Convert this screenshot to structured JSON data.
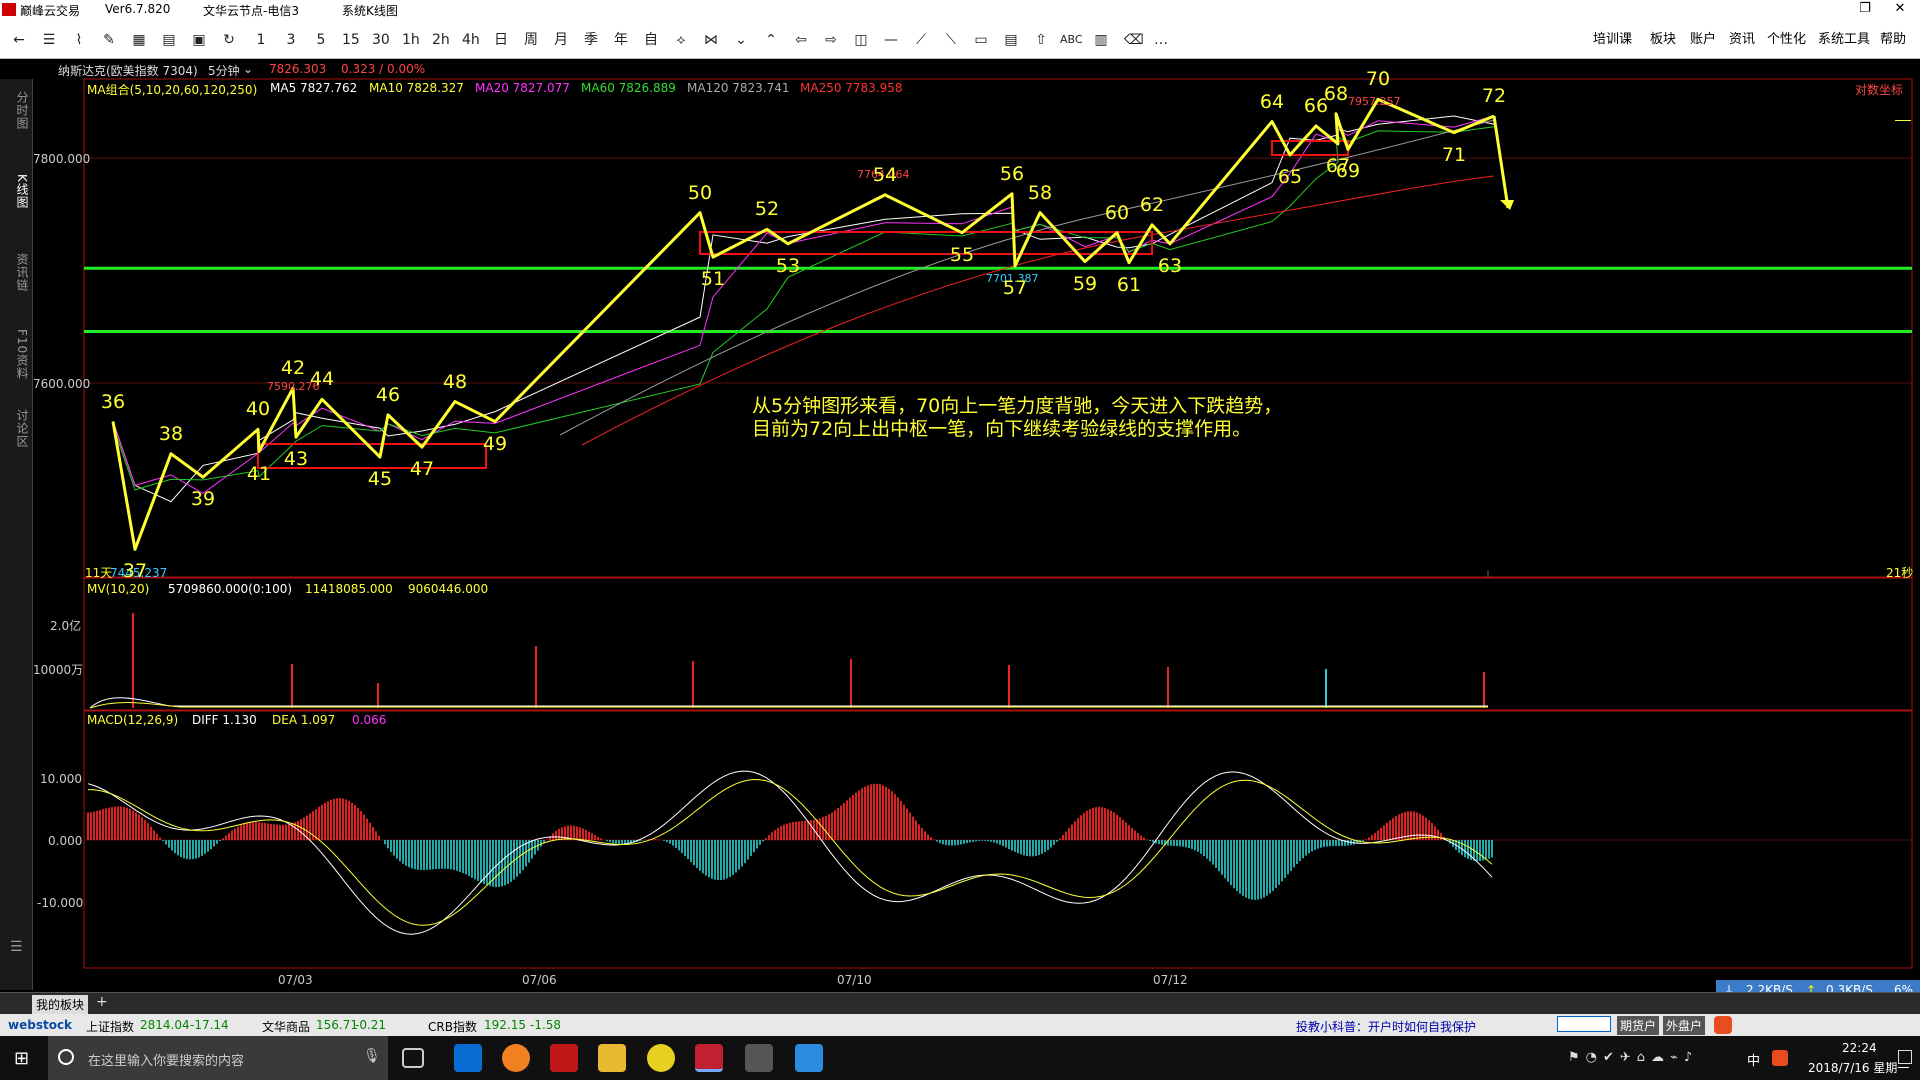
{
  "window": {
    "app_name": "巅峰云交易",
    "version": "Ver6.7.820",
    "server": "文华云节点-电信3",
    "menu_chart": "系统K线图",
    "close_icon": "close-icon",
    "maximize_icon": "maximize-icon"
  },
  "toolbar": {
    "periods": [
      "1",
      "3",
      "5",
      "15",
      "30",
      "1h",
      "2h",
      "4h",
      "日",
      "周",
      "月",
      "季",
      "年",
      "自"
    ],
    "abc_label": "ABC",
    "more_label": "…",
    "right_menu": [
      "培训课",
      "板块",
      "账户",
      "资讯",
      "个性化",
      "系统工具",
      "帮助"
    ]
  },
  "sidebar": {
    "tabs": [
      "分时图",
      "K线图",
      "资讯链",
      "F10资料",
      "讨论区"
    ]
  },
  "infobar": {
    "symbol": "纳斯达克(欧美指数 7304)",
    "period_label": "5分钟",
    "price": "7826.303",
    "change": "0.323 / 0.00%"
  },
  "ma_legend": {
    "name": "MA组合(5,10,20,60,120,250)",
    "items": [
      {
        "label": "MA5 7827.762",
        "color": "#ffffff"
      },
      {
        "label": "MA10 7828.327",
        "color": "#ffff33"
      },
      {
        "label": "MA20 7827.077",
        "color": "#ff33ff"
      },
      {
        "label": "MA60 7826.889",
        "color": "#33dd33"
      },
      {
        "label": "MA120 7823.741",
        "color": "#aaaaaa"
      },
      {
        "label": "MA250 7783.958",
        "color": "#ff3333"
      }
    ]
  },
  "labels": {
    "log_coord": "对数坐标",
    "days_label": "11天",
    "secs_label": "21秒",
    "min_price": "7445.237",
    "mark_7590": "7590.276",
    "mark_7764": "7764.064",
    "mark_7701": "7701.387",
    "mark_7957": "7957.257"
  },
  "annotation": {
    "line1": "从5分钟图形来看，70向上一笔力度背驰，今天进入下跌趋势，",
    "line2": "目前为72向上出中枢一笔，向下继续考验绿线的支撑作用。"
  },
  "volume_legend": {
    "name": "MV(10,20)",
    "v1": "5709860.000(0:100)",
    "v2": "11418085.000",
    "v3": "9060446.000"
  },
  "macd_legend": {
    "name": "MACD(12,26,9)",
    "diff": "DIFF 1.130",
    "dea": "DEA 1.097",
    "macd": "0.066"
  },
  "axes": {
    "price_ticks": [
      "7800.000",
      "7600.000"
    ],
    "volume_ticks": [
      "2.0亿",
      "10000万"
    ],
    "macd_ticks": [
      "10.000",
      "0.000",
      "-10.000"
    ],
    "date_ticks": [
      "07/03",
      "07/06",
      "07/10",
      "07/12"
    ]
  },
  "chart_data": {
    "type": "line",
    "waves": [
      {
        "label": "36",
        "price": 7560
      },
      {
        "label": "37",
        "price": 7445
      },
      {
        "label": "38",
        "price": 7531
      },
      {
        "label": "39",
        "price": 7510
      },
      {
        "label": "40",
        "price": 7553
      },
      {
        "label": "41",
        "price": 7533
      },
      {
        "label": "42",
        "price": 7590
      },
      {
        "label": "43",
        "price": 7546
      },
      {
        "label": "44",
        "price": 7580
      },
      {
        "label": "45",
        "price": 7528
      },
      {
        "label": "46",
        "price": 7566
      },
      {
        "label": "47",
        "price": 7537
      },
      {
        "label": "48",
        "price": 7578
      },
      {
        "label": "49",
        "price": 7560
      },
      {
        "label": "50",
        "price": 7748
      },
      {
        "label": "51",
        "price": 7708
      },
      {
        "label": "52",
        "price": 7733
      },
      {
        "label": "53",
        "price": 7720
      },
      {
        "label": "54",
        "price": 7764
      },
      {
        "label": "55",
        "price": 7730
      },
      {
        "label": "56",
        "price": 7765
      },
      {
        "label": "57",
        "price": 7700
      },
      {
        "label": "58",
        "price": 7748
      },
      {
        "label": "59",
        "price": 7704
      },
      {
        "label": "60",
        "price": 7730
      },
      {
        "label": "61",
        "price": 7703
      },
      {
        "label": "62",
        "price": 7737
      },
      {
        "label": "63",
        "price": 7720
      },
      {
        "label": "64",
        "price": 7830
      },
      {
        "label": "65",
        "price": 7800
      },
      {
        "label": "66",
        "price": 7826
      },
      {
        "label": "67",
        "price": 7810
      },
      {
        "label": "68",
        "price": 7837
      },
      {
        "label": "69",
        "price": 7805
      },
      {
        "label": "70",
        "price": 7850
      },
      {
        "label": "71",
        "price": 7820
      },
      {
        "label": "72",
        "price": 7835
      }
    ],
    "green_support_lines": [
      7698,
      7641
    ],
    "ylim": [
      7430,
      7880
    ]
  },
  "bottom": {
    "tab": "我的板块",
    "add": "+"
  },
  "status": {
    "brand": "webstock",
    "items": [
      {
        "name": "上证指数",
        "value": "2814.04",
        "chg": "-17.14"
      },
      {
        "name": "文华商品",
        "value": "156.71",
        "chg": "-0.21"
      },
      {
        "name": "CRB指数",
        "value": "192.15",
        "chg": "-1.58"
      }
    ],
    "notice": "投教小科普：开户时如何自我保护",
    "btn_futures": "期货户",
    "btn_forex": "外盘户"
  },
  "netspeed": {
    "down": "2.2KB/S",
    "up": "0.3KB/S",
    "pct": "6%"
  },
  "taskbar": {
    "search_placeholder": "在这里输入你要搜索的内容",
    "time": "22:24",
    "date": "2018/7/16 星期一",
    "ime": "中"
  }
}
